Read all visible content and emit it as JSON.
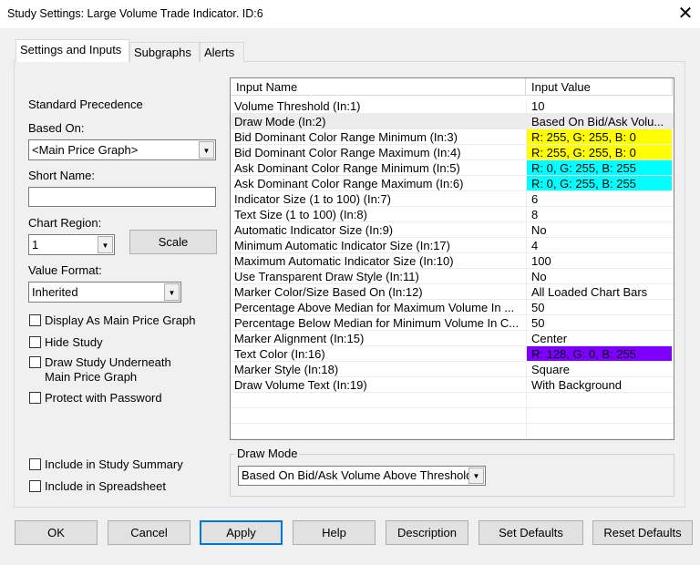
{
  "window": {
    "title": "Study Settings: Large Volume Trade Indicator. ID:6"
  },
  "tabs": [
    {
      "label": "Settings and Inputs"
    },
    {
      "label": "Subgraphs"
    },
    {
      "label": "Alerts"
    }
  ],
  "left": {
    "standard_precedence": "Standard Precedence",
    "based_on_label": "Based On:",
    "based_on_value": "<Main Price Graph>",
    "short_name_label": "Short Name:",
    "short_name_value": "",
    "chart_region_label": "Chart Region:",
    "chart_region_value": "1",
    "scale_button": "Scale",
    "value_format_label": "Value Format:",
    "value_format_value": "Inherited",
    "checkboxes": [
      {
        "label": "Display As Main Price Graph",
        "checked": false
      },
      {
        "label": "Hide Study",
        "checked": false
      },
      {
        "label": "Draw Study Underneath",
        "label2": "Main Price Graph",
        "checked": false
      },
      {
        "label": "Protect with Password",
        "checked": false
      }
    ],
    "bottom_checkboxes": [
      {
        "label": "Include in Study Summary",
        "checked": false
      },
      {
        "label": "Include in Spreadsheet",
        "checked": false
      }
    ]
  },
  "table": {
    "headers": [
      "Input Name",
      "Input Value"
    ],
    "rows": [
      {
        "name": "Volume Threshold   (In:1)",
        "value": "10"
      },
      {
        "name": "Draw Mode   (In:2)",
        "value": "Based On Bid/Ask Volu...",
        "selected": true
      },
      {
        "name": "Bid Dominant Color Range Minimum   (In:3)",
        "value": "R: 255, G: 255, B: 0",
        "color": "#ffff00"
      },
      {
        "name": "Bid Dominant Color Range Maximum   (In:4)",
        "value": "R: 255, G: 255, B: 0",
        "color": "#ffff00"
      },
      {
        "name": "Ask Dominant Color Range Minimum   (In:5)",
        "value": "R: 0, G: 255, B: 255",
        "color": "#00ffff"
      },
      {
        "name": "Ask Dominant Color Range Maximum   (In:6)",
        "value": "R: 0, G: 255, B: 255",
        "color": "#00ffff"
      },
      {
        "name": "Indicator Size (1 to 100)   (In:7)",
        "value": "6"
      },
      {
        "name": "Text Size (1 to 100)   (In:8)",
        "value": "8"
      },
      {
        "name": "Automatic Indicator Size   (In:9)",
        "value": "No"
      },
      {
        "name": "Minimum Automatic Indicator Size   (In:17)",
        "value": "4"
      },
      {
        "name": "Maximum Automatic Indicator Size   (In:10)",
        "value": "100"
      },
      {
        "name": "Use Transparent Draw Style   (In:11)",
        "value": "No"
      },
      {
        "name": "Marker Color/Size Based On   (In:12)",
        "value": "All Loaded Chart Bars"
      },
      {
        "name": "Percentage Above Median for Maximum Volume In ...",
        "value": "50"
      },
      {
        "name": "Percentage Below Median for Minimum Volume In C...",
        "value": "50"
      },
      {
        "name": "Marker Alignment   (In:15)",
        "value": "Center"
      },
      {
        "name": "Text Color   (In:16)",
        "value": "R: 128, G: 0, B: 255",
        "color": "#8000ff"
      },
      {
        "name": "Marker Style   (In:18)",
        "value": "Square"
      },
      {
        "name": "Draw Volume Text   (In:19)",
        "value": "With Background"
      }
    ]
  },
  "draw_mode": {
    "label": "Draw Mode",
    "value": "Based On Bid/Ask Volume Above Threshold"
  },
  "buttons": [
    "OK",
    "Cancel",
    "Apply",
    "Help",
    "Description",
    "Set Defaults",
    "Reset Defaults"
  ]
}
